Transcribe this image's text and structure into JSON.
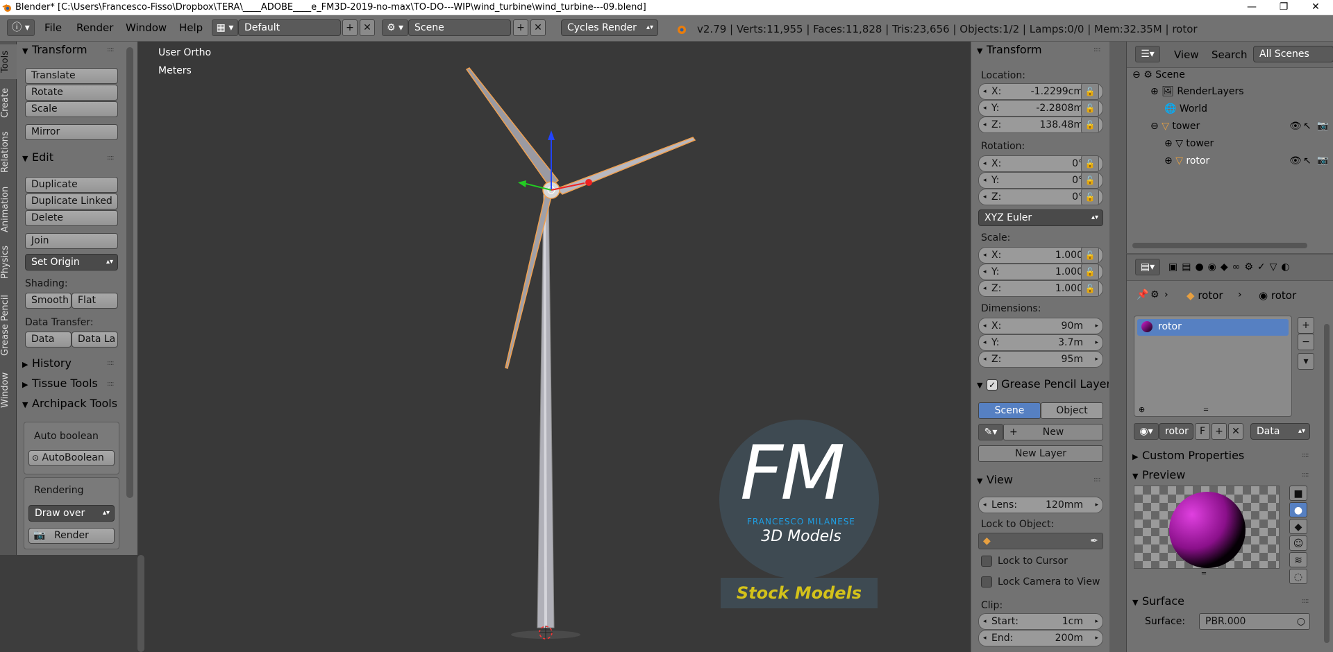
{
  "titlebar": {
    "title": "Blender* [C:\\Users\\Francesco-Fisso\\Dropbox\\TERA\\____ADOBE____e_FM3D-2019-no-max\\TO-DO---WIP\\wind_turbine\\wind_turbine---09.blend]",
    "minimize": "—",
    "restore": "❐",
    "close": "✕"
  },
  "menubar": {
    "menus": [
      "File",
      "Render",
      "Window",
      "Help"
    ],
    "layout_value": "Default",
    "scene_value": "Scene",
    "engine_value": "Cycles Render",
    "info": "v2.79 | Verts:11,955 | Faces:11,828 | Tris:23,656 | Objects:1/2 | Lamps:0/0 | Mem:32.35M | rotor"
  },
  "tool_tabs": [
    "Tools",
    "Create",
    "Relations",
    "Animation",
    "Physics",
    "Grease Pencil",
    "Window"
  ],
  "tools": {
    "transform_header": "Transform",
    "translate": "Translate",
    "rotate": "Rotate",
    "scale": "Scale",
    "mirror": "Mirror",
    "edit_header": "Edit",
    "duplicate": "Duplicate",
    "duplicate_linked": "Duplicate Linked",
    "delete": "Delete",
    "join": "Join",
    "set_origin": "Set Origin",
    "shading_label": "Shading:",
    "smooth": "Smooth",
    "flat": "Flat",
    "data_transfer_label": "Data Transfer:",
    "data": "Data",
    "data_la": "Data La",
    "history_header": "History",
    "tissue_header": "Tissue Tools",
    "archipack_header": "Archipack Tools",
    "auto_boolean_label": "Auto boolean",
    "autoboolean_btn": "AutoBoolean",
    "rendering_label": "Rendering",
    "draw_over": "Draw over",
    "render_btn": "Render"
  },
  "viewport": {
    "view_name": "User Ortho",
    "units": "Meters",
    "logo_initials": "FM",
    "logo_name": "FRANCESCO MILANESE",
    "logo_sub": "3D Models",
    "logo_banner": "Stock Models"
  },
  "npanel": {
    "transform_header": "Transform",
    "location_label": "Location:",
    "loc": [
      {
        "l": "X:",
        "v": "-1.2299cm"
      },
      {
        "l": "Y:",
        "v": "-2.2808m"
      },
      {
        "l": "Z:",
        "v": "138.48m"
      }
    ],
    "rotation_label": "Rotation:",
    "rot": [
      {
        "l": "X:",
        "v": "0°"
      },
      {
        "l": "Y:",
        "v": "0°"
      },
      {
        "l": "Z:",
        "v": "0°"
      }
    ],
    "rotation_mode": "XYZ Euler",
    "scale_label": "Scale:",
    "scale": [
      {
        "l": "X:",
        "v": "1.000"
      },
      {
        "l": "Y:",
        "v": "1.000"
      },
      {
        "l": "Z:",
        "v": "1.000"
      }
    ],
    "dimensions_label": "Dimensions:",
    "dim": [
      {
        "l": "X:",
        "v": "90m"
      },
      {
        "l": "Y:",
        "v": "3.7m"
      },
      {
        "l": "Z:",
        "v": "95m"
      }
    ],
    "gp_header": "Grease Pencil Layer",
    "gp_scene": "Scene",
    "gp_object": "Object",
    "gp_new": "New",
    "gp_new_layer": "New Layer",
    "view_header": "View",
    "lens_label": "Lens:",
    "lens_value": "120mm",
    "lock_object_label": "Lock to Object:",
    "lock_cursor": "Lock to Cursor",
    "lock_camera": "Lock Camera to View",
    "clip_label": "Clip:",
    "clip_start_label": "Start:",
    "clip_start": "1cm",
    "clip_end_label": "End:",
    "clip_end": "200m"
  },
  "outliner": {
    "view_menu": "View",
    "search_menu": "Search",
    "filter_value": "All Scenes",
    "rows": [
      "Scene",
      "RenderLayers",
      "World",
      "tower",
      "tower",
      "rotor"
    ]
  },
  "properties": {
    "breadcrumb_object": "rotor",
    "breadcrumb_material": "rotor",
    "material_slot": "rotor",
    "material_name": "rotor",
    "f_label": "F",
    "link_value": "Data",
    "custom_props": "Custom Properties",
    "preview_header": "Preview",
    "surface_header": "Surface",
    "surface_label": "Surface:",
    "surface_value": "PBR.000"
  },
  "colors": {
    "accent_blue": "#5680c2",
    "selection_orange": "#f0a050",
    "logo_cyan": "#1ea0e6",
    "logo_yellow": "#d4c21a"
  }
}
